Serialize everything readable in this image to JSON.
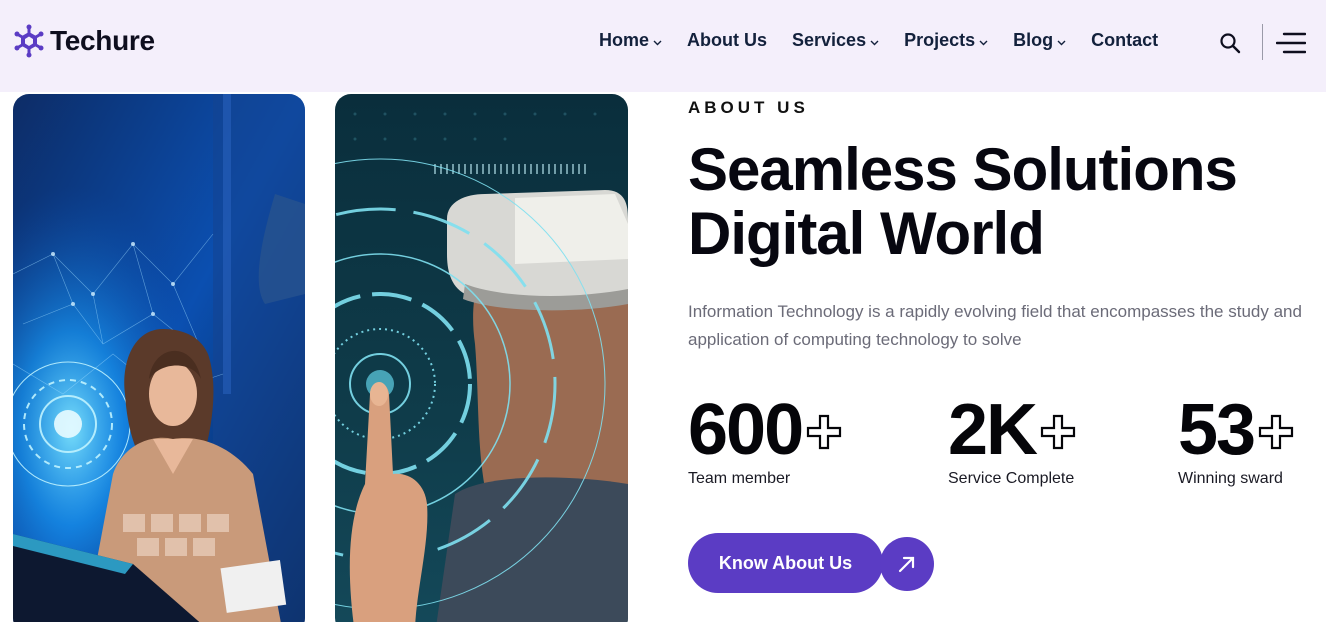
{
  "brand": {
    "name": "Techure",
    "logo_icon": "snowflake-hex-icon",
    "color": "#5b3cc4"
  },
  "nav": {
    "items": [
      {
        "label": "Home",
        "dropdown": true
      },
      {
        "label": "About Us",
        "dropdown": false
      },
      {
        "label": "Services",
        "dropdown": true
      },
      {
        "label": "Projects",
        "dropdown": true
      },
      {
        "label": "Blog",
        "dropdown": true
      },
      {
        "label": "Contact",
        "dropdown": false
      }
    ],
    "search_icon": "search-icon",
    "menu_icon": "hamburger-menu-icon"
  },
  "about": {
    "eyebrow": "ABOUT US",
    "headline_line1": "Seamless Solutions",
    "headline_line2": "Digital World",
    "description": "Information Technology is a rapidly evolving field that encompasses the study and application of computing technology to solve",
    "stats": [
      {
        "value": "600",
        "label": "Team member"
      },
      {
        "value": "2K",
        "label": "Service Complete"
      },
      {
        "value": "53",
        "label": "Winning sward"
      }
    ],
    "cta_label": "Know About Us",
    "cta_icon": "arrow-up-right-icon"
  },
  "colors": {
    "header_bg": "#f4effb",
    "accent": "#5b3cc4",
    "text": "#070710",
    "muted": "#6b6b78"
  }
}
